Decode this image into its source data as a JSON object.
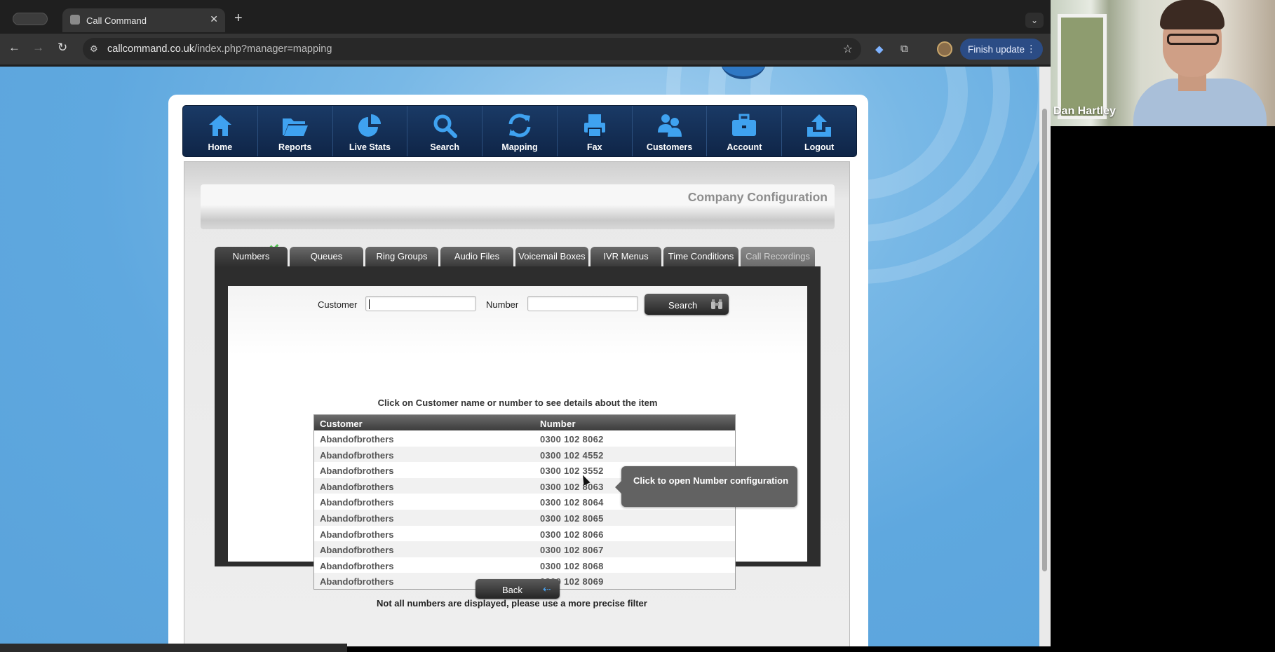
{
  "browser": {
    "tab_title": "Call Command",
    "url_host": "callcommand.co.uk",
    "url_path": "/index.php?manager=mapping",
    "finish_update_label": "Finish update"
  },
  "nav": {
    "items": [
      {
        "label": "Home",
        "icon": "home-icon"
      },
      {
        "label": "Reports",
        "icon": "folder-icon"
      },
      {
        "label": "Live Stats",
        "icon": "pie-chart-icon"
      },
      {
        "label": "Search",
        "icon": "search-icon"
      },
      {
        "label": "Mapping",
        "icon": "refresh-icon"
      },
      {
        "label": "Fax",
        "icon": "printer-icon"
      },
      {
        "label": "Customers",
        "icon": "users-icon"
      },
      {
        "label": "Account",
        "icon": "briefcase-icon"
      },
      {
        "label": "Logout",
        "icon": "upload-icon"
      }
    ]
  },
  "header": {
    "title": "Company Configuration"
  },
  "tabs": [
    "Numbers",
    "Queues",
    "Ring Groups",
    "Audio Files",
    "Voicemail Boxes",
    "IVR Menus",
    "Time Conditions",
    "Call Recordings"
  ],
  "search": {
    "customer_label": "Customer",
    "customer_value": "",
    "number_label": "Number",
    "number_value": "",
    "button_label": "Search"
  },
  "hint": "Click on Customer name or number to see details about the item",
  "table": {
    "headers": [
      "Customer",
      "Number"
    ],
    "rows": [
      [
        "Abandofbrothers",
        "0300 102 8062"
      ],
      [
        "Abandofbrothers",
        "0300 102 4552"
      ],
      [
        "Abandofbrothers",
        "0300 102 3552"
      ],
      [
        "Abandofbrothers",
        "0300 102 8063"
      ],
      [
        "Abandofbrothers",
        "0300 102 8064"
      ],
      [
        "Abandofbrothers",
        "0300 102 8065"
      ],
      [
        "Abandofbrothers",
        "0300 102 8066"
      ],
      [
        "Abandofbrothers",
        "0300 102 8067"
      ],
      [
        "Abandofbrothers",
        "0300 102 8068"
      ],
      [
        "Abandofbrothers",
        "0300 102 8069"
      ]
    ]
  },
  "tooltip": "Click to open Number configuration",
  "note": "Not all numbers are displayed, please use a more precise filter",
  "back_label": "Back",
  "video": {
    "participant_name": "Dan Hartley"
  },
  "colors": {
    "nav_bg": "#13305a",
    "tooltip_bg": "#626262",
    "page_bg": "#5fa8df"
  }
}
